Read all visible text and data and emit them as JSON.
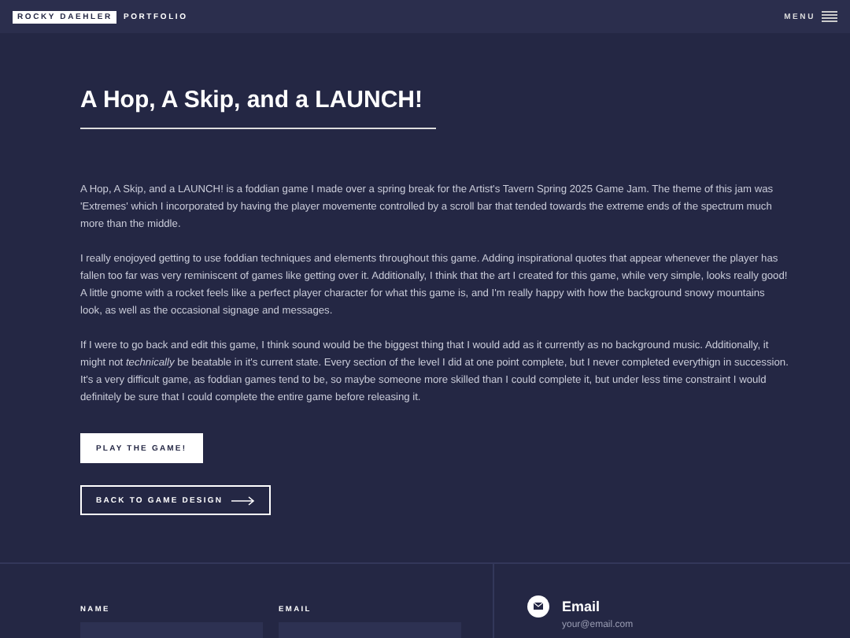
{
  "header": {
    "brand": "ROCKY DAEHLER",
    "section": "PORTFOLIO",
    "menu": "MENU"
  },
  "title": "A Hop, A Skip, and a LAUNCH!",
  "paragraphs": [
    "A Hop, A Skip, and a LAUNCH! is a foddian game I made over a spring break for the Artist's Tavern Spring 2025 Game Jam. The theme of this jam was 'Extremes' which I incorporated by having the player movemente controlled by a scroll bar that tended towards the extreme ends of the spectrum much more than the middle.",
    "I really enojoyed getting to use foddian techniques and elements throughout this game. Adding inspirational quotes that appear whenever the player has fallen too far was very reminiscent of games like getting over it. Additionally, I think that the art I created for this game, while very simple, looks really good! A little gnome with a rocket feels like a perfect player character for what this game is, and I'm really happy with how the background snowy mountains look, as well as the occasional signage and messages.",
    "If I were to go back and edit this game, I think sound would be the biggest thing that I would add as it currently as no background music. Additionally, it might not *technically* be beatable in it's current state. Every section of the level I did at one point complete, but I never completed everythign in succession. It's a very difficult game, as foddian games tend to be, so maybe someone more skilled than I could complete it, but under less time constraint I would definitely be sure that I could complete the entire game before releasing it."
  ],
  "buttons": [
    {
      "label": "PLAY THE GAME!",
      "kind": "solid"
    },
    {
      "label": "BACK TO GAME DESIGN",
      "kind": "outline"
    }
  ],
  "footer": {
    "fields": [
      {
        "label": "NAME"
      },
      {
        "label": "EMAIL"
      }
    ],
    "contact": {
      "title": "Email",
      "value": "your@email.com"
    }
  }
}
